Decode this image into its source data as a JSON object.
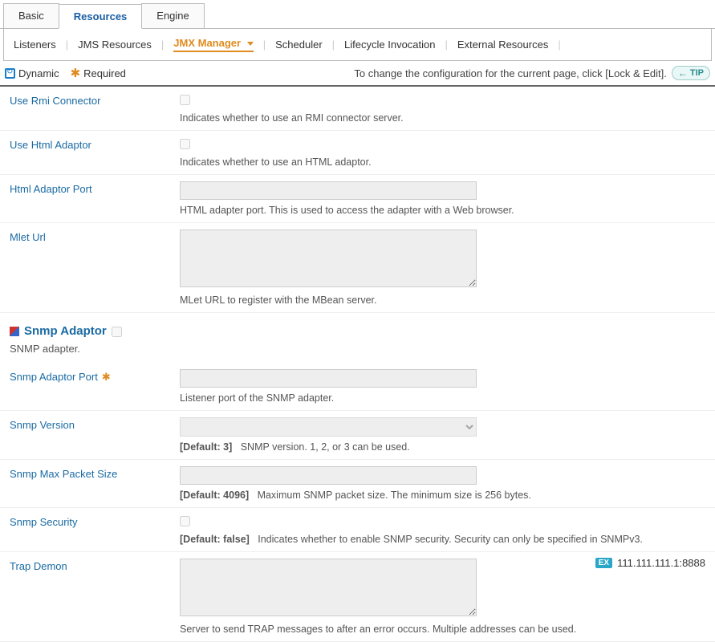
{
  "top_tabs": {
    "basic": "Basic",
    "resources": "Resources",
    "engine": "Engine"
  },
  "sub_tabs": {
    "listeners": "Listeners",
    "jms_resources": "JMS Resources",
    "jmx_manager": "JMX Manager",
    "scheduler": "Scheduler",
    "lifecycle_invocation": "Lifecycle Invocation",
    "external_resources": "External Resources"
  },
  "legend": {
    "dynamic": "Dynamic",
    "required": "Required",
    "tip_text": "To change the configuration for the current page, click [Lock & Edit].",
    "tip_label": "TIP"
  },
  "fields": {
    "use_rmi": {
      "label": "Use Rmi Connector",
      "help": "Indicates whether to use an RMI connector server.",
      "checked": false
    },
    "use_html": {
      "label": "Use Html Adaptor",
      "help": "Indicates whether to use an HTML adaptor.",
      "checked": false
    },
    "html_port": {
      "label": "Html Adaptor Port",
      "help": "HTML adapter port. This is used to access the adapter with a Web browser.",
      "value": ""
    },
    "mlet_url": {
      "label": "Mlet Url",
      "help": "MLet URL to register with the MBean server.",
      "value": ""
    }
  },
  "snmp_section": {
    "title": "Snmp Adaptor",
    "desc": "SNMP adapter.",
    "checked": false
  },
  "snmp": {
    "port": {
      "label": "Snmp Adaptor Port",
      "help": "Listener port of the SNMP adapter.",
      "value": ""
    },
    "version": {
      "label": "Snmp Version",
      "default": "[Default: 3]",
      "help": "SNMP version. 1, 2, or 3 can be used.",
      "value": ""
    },
    "max_packet": {
      "label": "Snmp Max Packet Size",
      "default": "[Default: 4096]",
      "help": "Maximum SNMP packet size. The minimum size is 256 bytes.",
      "value": ""
    },
    "security": {
      "label": "Snmp Security",
      "default": "[Default: false]",
      "help": "Indicates whether to enable SNMP security. Security can only be specified in SNMPv3.",
      "checked": false
    },
    "trap_demon": {
      "label": "Trap Demon",
      "help": "Server to send TRAP messages to after an error occurs. Multiple addresses can be used.",
      "value": "",
      "example_label": "EX",
      "example_value": "111.111.111.1:8888"
    }
  }
}
